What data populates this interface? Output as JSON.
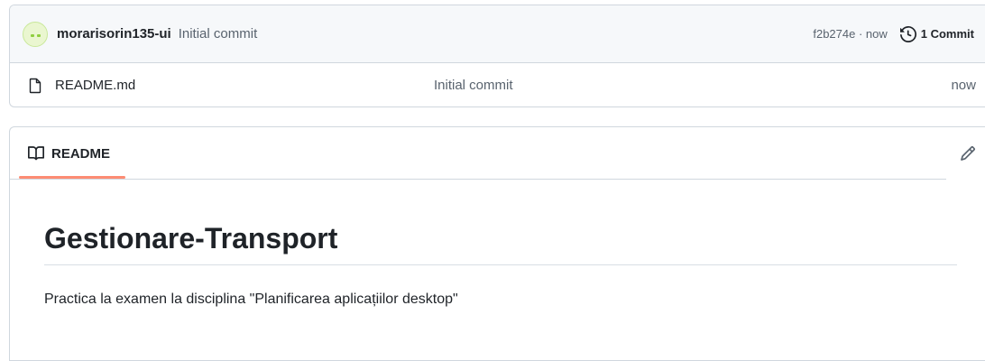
{
  "commit_bar": {
    "author": "morarisorin135-ui",
    "message": "Initial commit",
    "meta": "f2b274e · now",
    "history_label": "1 Commit",
    "avatar_icon": "identicon-avatar",
    "history_icon": "history-icon"
  },
  "files": [
    {
      "name": "README.md",
      "commit": "Initial commit",
      "time": "now",
      "icon": "file-icon"
    }
  ],
  "readme": {
    "tab_label": "README",
    "tab_icon": "book-icon",
    "edit_icon": "pencil-icon",
    "title": "Gestionare-Transport",
    "description": "Practica la examen la disciplina \"Planificarea aplicațiilor desktop\""
  },
  "colors": {
    "accent_underline": "#fd8c73",
    "border": "#d0d7de",
    "muted_text": "#59636e",
    "header_bg": "#f6f8fa"
  }
}
